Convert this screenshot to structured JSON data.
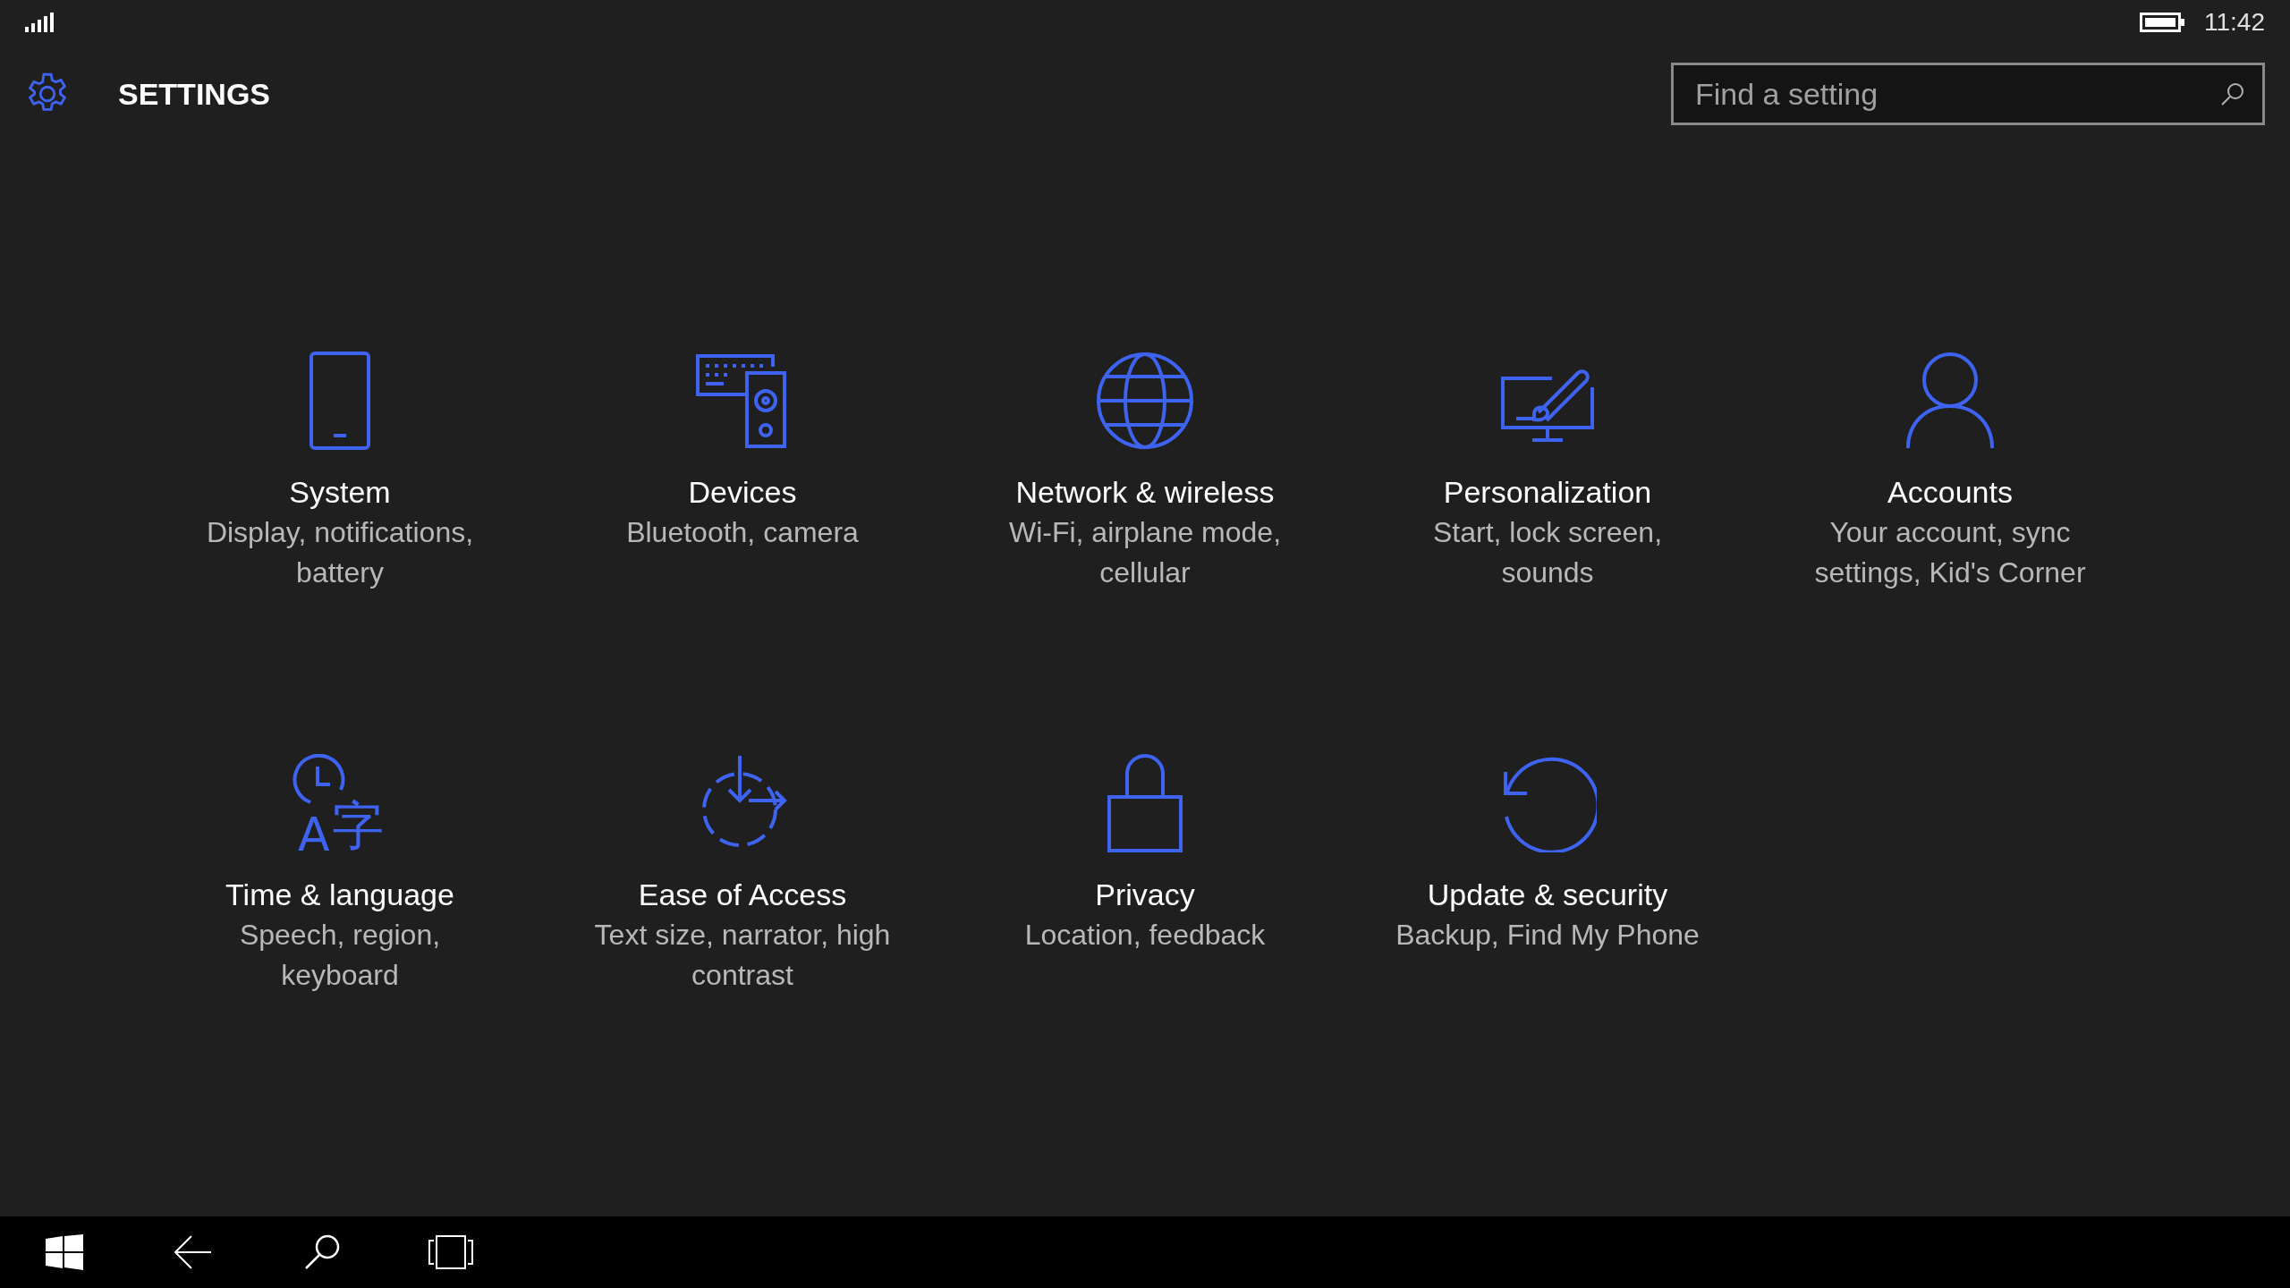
{
  "status_bar": {
    "time": "11:42"
  },
  "header": {
    "title": "SETTINGS"
  },
  "search": {
    "placeholder": "Find a setting"
  },
  "categories": [
    {
      "title": "System",
      "subtitle": "Display, notifications, battery"
    },
    {
      "title": "Devices",
      "subtitle": "Bluetooth, camera"
    },
    {
      "title": "Network & wireless",
      "subtitle": "Wi-Fi, airplane mode, cellular"
    },
    {
      "title": "Personalization",
      "subtitle": "Start, lock screen, sounds"
    },
    {
      "title": "Accounts",
      "subtitle": "Your account, sync settings, Kid's Corner"
    },
    {
      "title": "Time & language",
      "subtitle": "Speech, region, keyboard",
      "icon_text": [
        "A",
        "字"
      ]
    },
    {
      "title": "Ease of Access",
      "subtitle": "Text size, narrator, high contrast"
    },
    {
      "title": "Privacy",
      "subtitle": "Location, feedback"
    },
    {
      "title": "Update & security",
      "subtitle": "Backup, Find My Phone"
    }
  ]
}
